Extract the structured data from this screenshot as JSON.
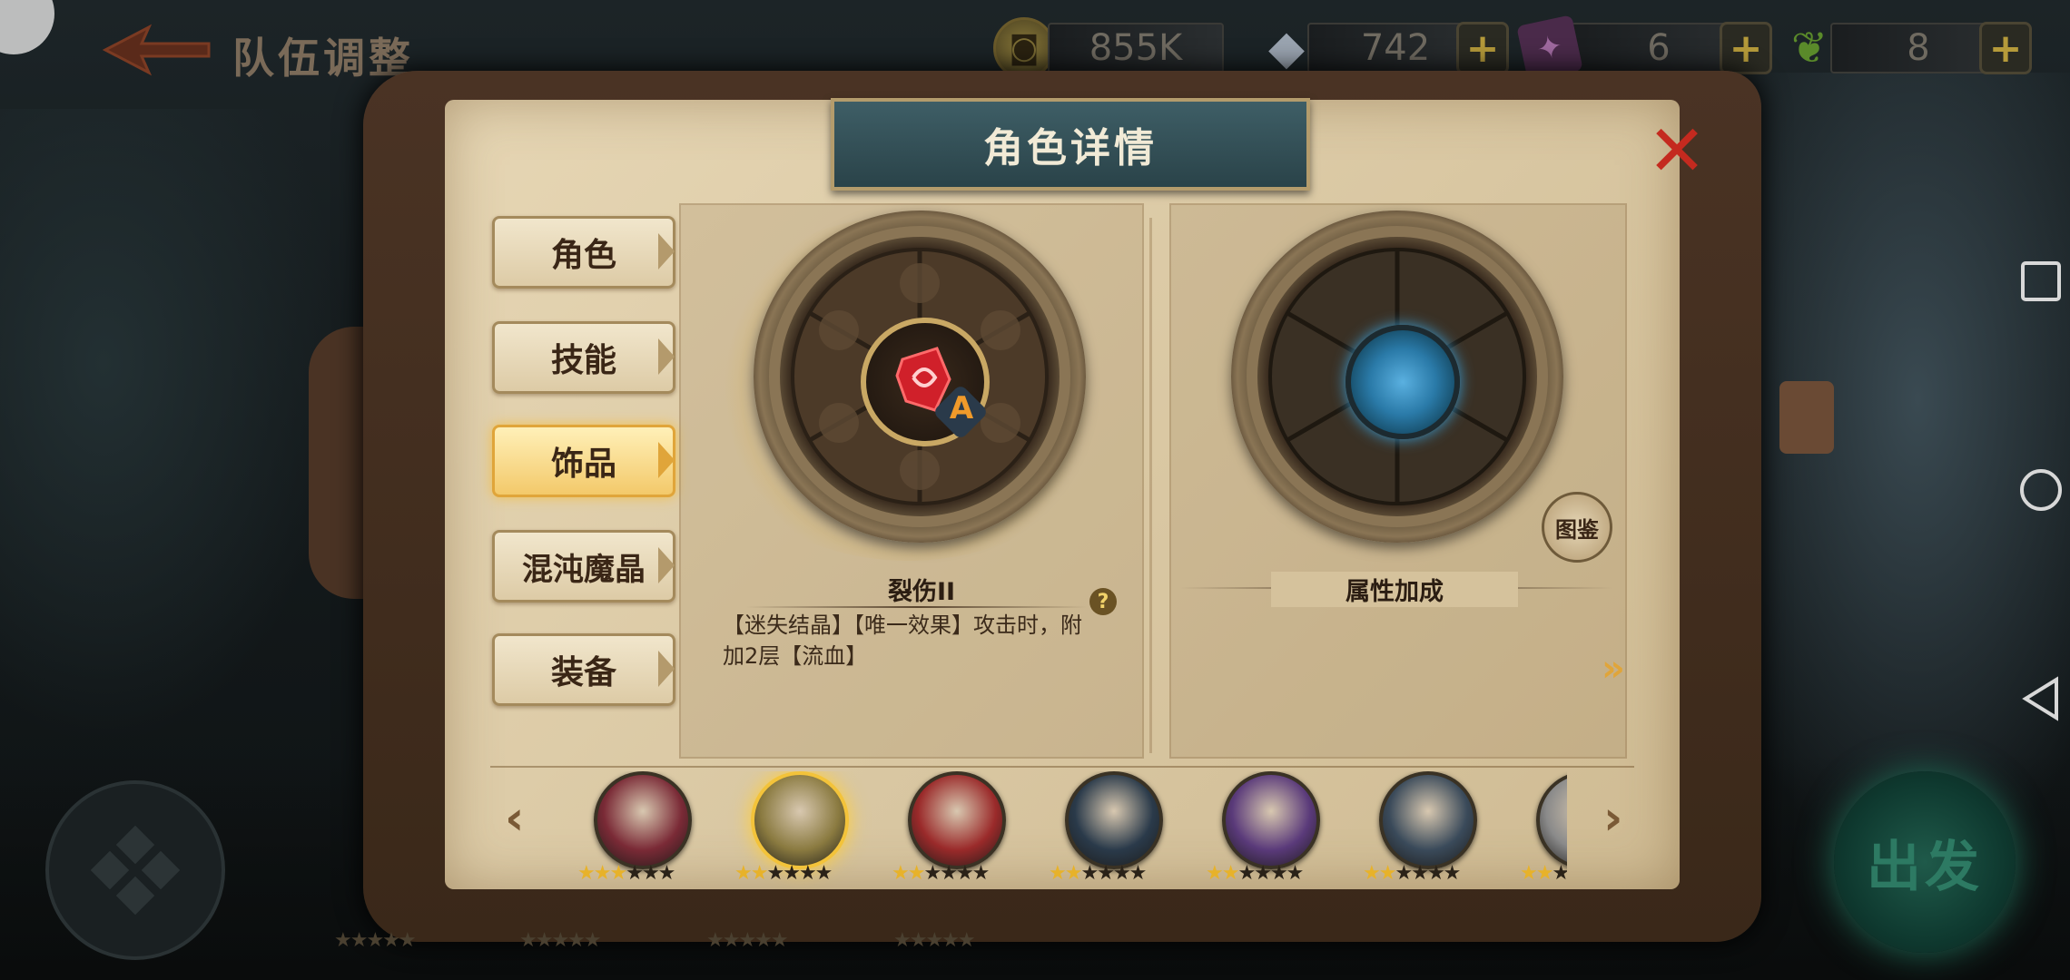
{
  "header": {
    "title": "队伍调整",
    "resources": [
      {
        "icon": "gold-coin-icon",
        "value": "855K",
        "has_plus": false
      },
      {
        "icon": "diamond-icon",
        "value": "742",
        "has_plus": true
      },
      {
        "icon": "purple-ticket-icon",
        "value": "6",
        "has_plus": true
      },
      {
        "icon": "green-rune-icon",
        "value": "8",
        "has_plus": true
      }
    ],
    "plus_label": "+"
  },
  "dialog": {
    "title": "角色详情",
    "close_label": "✕"
  },
  "tabs": [
    "角色",
    "技能",
    "饰品",
    "混沌魔晶",
    "装备"
  ],
  "active_tab": "饰品",
  "left_panel": {
    "gem_badge": "A",
    "item_name": "裂伤II",
    "item_desc_line1": "【迷失结晶】【唯一效果】攻击时，附",
    "item_desc_line2": "加2层【流血】",
    "help_label": "?"
  },
  "right_panel": {
    "title": "属性加成",
    "codex_label": "图鉴",
    "next_label": "»"
  },
  "roster": {
    "prev_label": "‹",
    "next_label": "›",
    "selected_index": 1,
    "heroes": [
      {
        "name": "hero-white-hair",
        "stars": 3,
        "color": "#7a2a36"
      },
      {
        "name": "hero-blonde-knight",
        "stars": 2,
        "color": "#8a7a40"
      },
      {
        "name": "hero-red-hat",
        "stars": 2,
        "color": "#9a2a2a"
      },
      {
        "name": "hero-dark-hair",
        "stars": 2,
        "color": "#2a3a4a"
      },
      {
        "name": "hero-purple-mage",
        "stars": 2,
        "color": "#5a3a7a"
      },
      {
        "name": "hero-masked-gunner",
        "stars": 2,
        "color": "#3a4a5a"
      },
      {
        "name": "hero-pale",
        "stars": 2,
        "color": "#8a8a8a"
      }
    ]
  },
  "go_button": "出发",
  "colors": {
    "accent_gold": "#e7b22a",
    "close_red": "#c42a1f",
    "banner_teal": "#2a4349"
  }
}
